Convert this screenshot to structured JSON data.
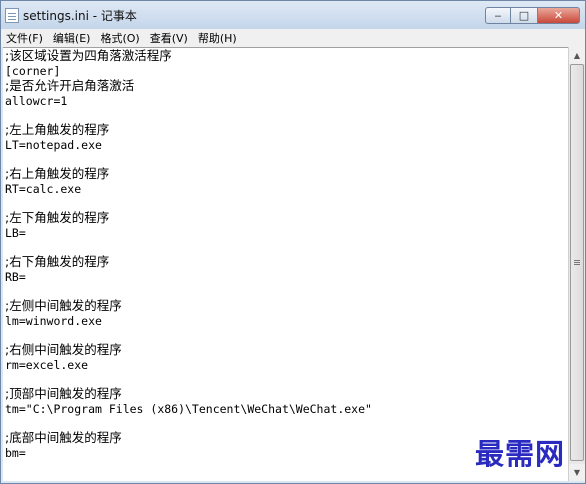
{
  "window": {
    "title": "settings.ini - 记事本",
    "controls": {
      "minimize_glyph": "‒",
      "maximize_glyph": "□",
      "close_glyph": "✕"
    }
  },
  "menu": {
    "items": [
      "文件(F)",
      "编辑(E)",
      "格式(O)",
      "查看(V)",
      "帮助(H)"
    ]
  },
  "editor": {
    "lines": [
      ";该区域设置为四角落激活程序",
      "[corner]",
      ";是否允许开启角落激活",
      "allowcr=1",
      "",
      ";左上角触发的程序",
      "LT=notepad.exe",
      "",
      ";右上角触发的程序",
      "RT=calc.exe",
      "",
      ";左下角触发的程序",
      "LB=",
      "",
      ";右下角触发的程序",
      "RB=",
      "",
      ";左侧中间触发的程序",
      "lm=winword.exe",
      "",
      ";右侧中间触发的程序",
      "rm=excel.exe",
      "",
      ";顶部中间触发的程序",
      "tm=\"C:\\Program Files (x86)\\Tencent\\WeChat\\WeChat.exe\"",
      "",
      ";底部中间触发的程序",
      "bm="
    ]
  },
  "scrollbar": {
    "up_glyph": "▲",
    "down_glyph": "▼"
  },
  "watermark": {
    "text": "最需网"
  },
  "icons": {
    "app": "notepad-icon",
    "minimize": "minimize-icon",
    "maximize": "maximize-icon",
    "close": "close-icon"
  }
}
